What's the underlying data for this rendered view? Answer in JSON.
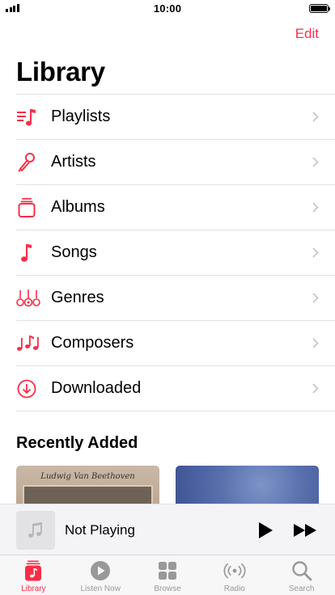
{
  "status_bar": {
    "time": "10:00"
  },
  "header": {
    "edit_label": "Edit",
    "title": "Library"
  },
  "library_items": [
    {
      "label": "Playlists",
      "icon": "playlist-icon"
    },
    {
      "label": "Artists",
      "icon": "microphone-icon"
    },
    {
      "label": "Albums",
      "icon": "album-stack-icon"
    },
    {
      "label": "Songs",
      "icon": "music-note-icon"
    },
    {
      "label": "Genres",
      "icon": "guitars-icon"
    },
    {
      "label": "Composers",
      "icon": "music-notes-icon"
    },
    {
      "label": "Downloaded",
      "icon": "download-circle-icon"
    }
  ],
  "recently_added": {
    "title": "Recently Added",
    "albums": [
      {
        "cover_text": "Ludwig Van Beethoven"
      },
      {
        "cover_text": ""
      }
    ]
  },
  "mini_player": {
    "title": "Not Playing"
  },
  "tab_bar": {
    "active": "Library",
    "tabs": [
      {
        "label": "Library",
        "icon": "library-icon"
      },
      {
        "label": "Listen Now",
        "icon": "play-circle-icon"
      },
      {
        "label": "Browse",
        "icon": "grid-icon"
      },
      {
        "label": "Radio",
        "icon": "radio-waves-icon"
      },
      {
        "label": "Search",
        "icon": "magnifier-icon"
      }
    ]
  },
  "colors": {
    "accent": "#fa2d48",
    "inactive": "#999999"
  }
}
